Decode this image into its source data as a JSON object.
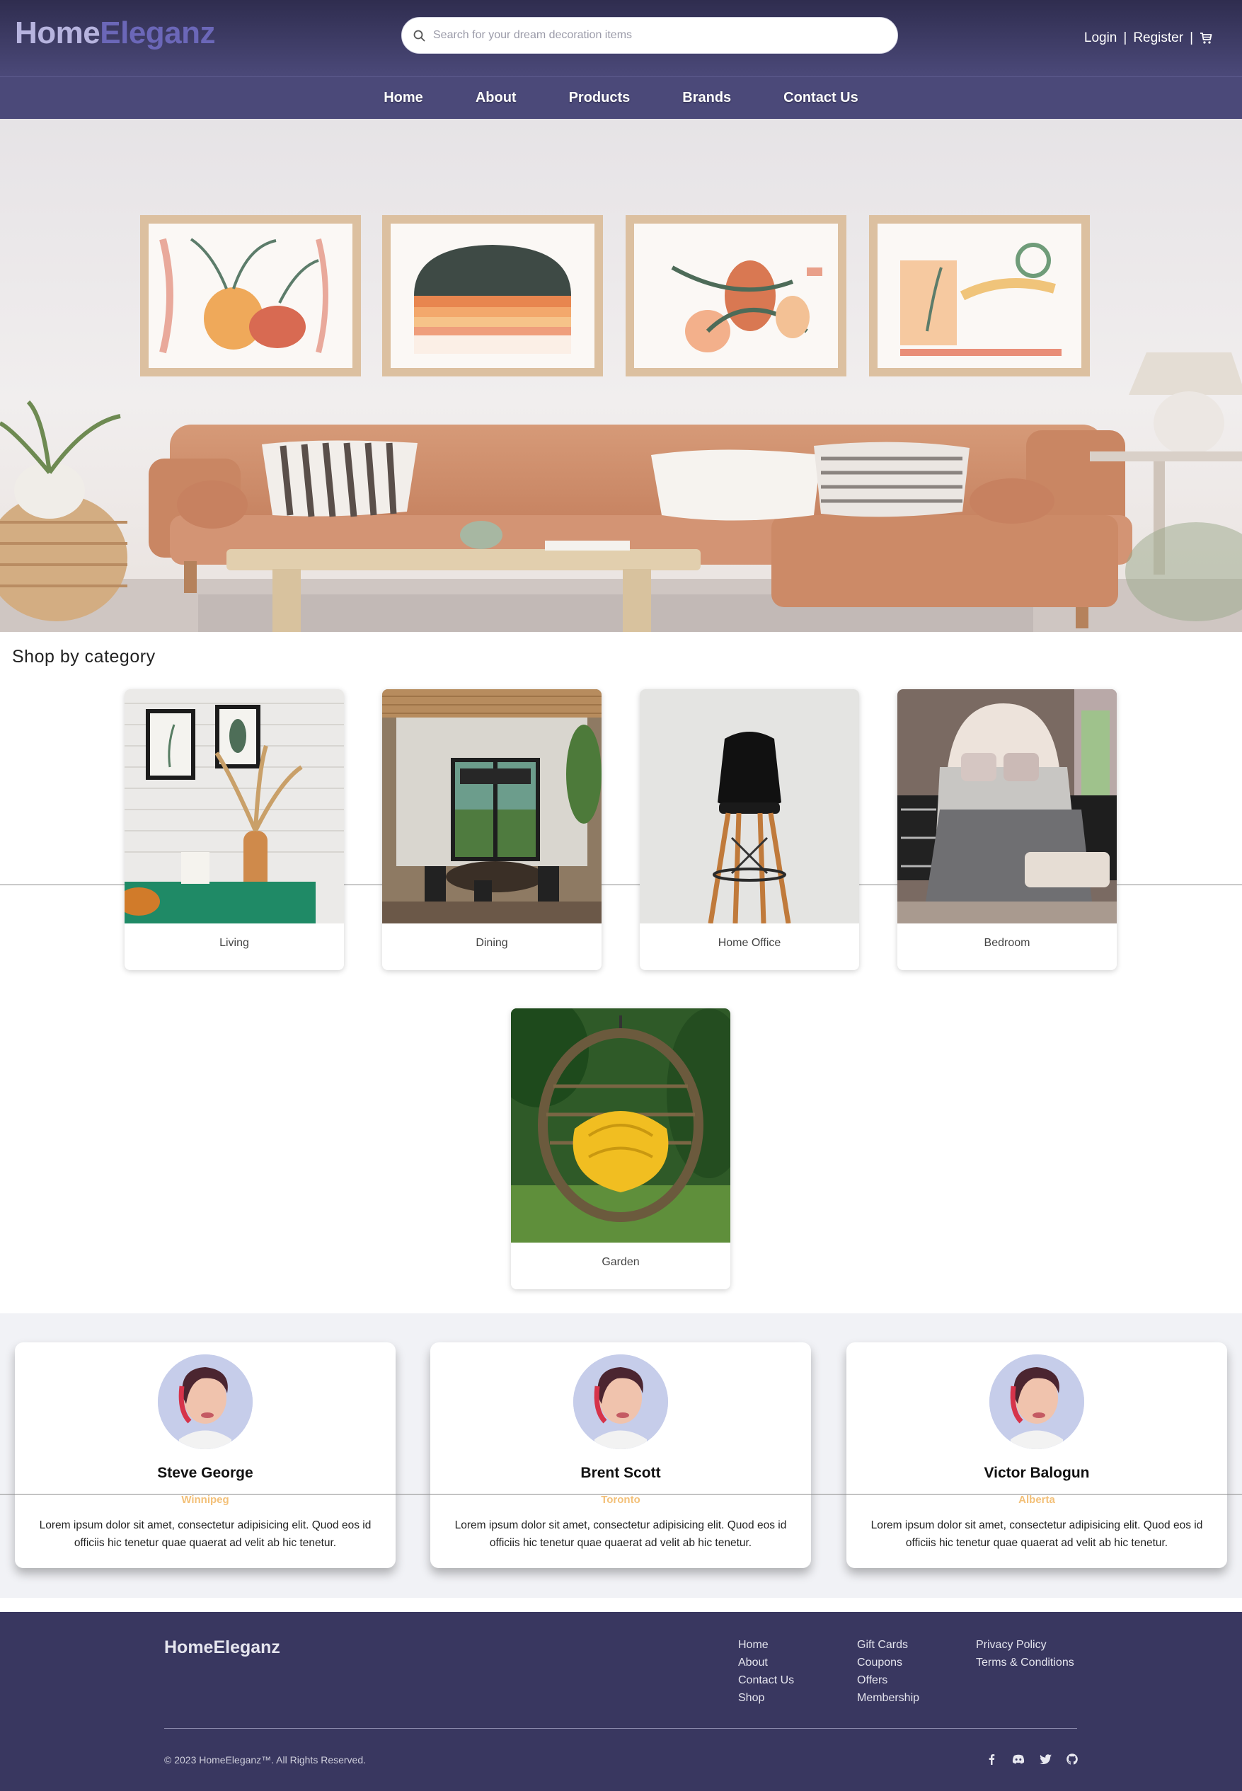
{
  "brand": {
    "name_part1": "Home",
    "name_part2": "Eleganz"
  },
  "search": {
    "placeholder": "Search for your dream decoration items",
    "icon": "search-icon"
  },
  "auth": {
    "login": "Login",
    "sep": "|",
    "register": "Register",
    "cart_icon": "cart-icon"
  },
  "nav": {
    "items": [
      "Home",
      "About",
      "Products",
      "Brands",
      "Contact Us"
    ]
  },
  "hero": {
    "image": "living-room-sofa-with-framed-art"
  },
  "categories": {
    "title": "Shop by category",
    "items": [
      "Living",
      "Dining",
      "Home Office",
      "Bedroom",
      "Garden"
    ]
  },
  "testimonials": [
    {
      "name": "Steve George",
      "city": "Winnipeg",
      "text": "Lorem ipsum dolor sit amet, consectetur adipisicing elit. Quod eos id officiis hic tenetur quae quaerat ad velit ab hic tenetur."
    },
    {
      "name": "Brent Scott",
      "city": "Toronto",
      "text": "Lorem ipsum dolor sit amet, consectetur adipisicing elit. Quod eos id officiis hic tenetur quae quaerat ad velit ab hic tenetur."
    },
    {
      "name": "Victor Balogun",
      "city": "Alberta",
      "text": "Lorem ipsum dolor sit amet, consectetur adipisicing elit. Quod eos id officiis hic tenetur quae quaerat ad velit ab hic tenetur."
    }
  ],
  "footer": {
    "logo": "HomeEleganz",
    "col1": [
      "Home",
      "About",
      "Contact Us",
      "Shop"
    ],
    "col2": [
      "Gift Cards",
      "Coupons",
      "Offers",
      "Membership"
    ],
    "col3": [
      "Privacy Policy",
      "Terms & Conditions"
    ],
    "copyright": "© 2023 HomeEleganz™. All Rights Reserved.",
    "social": [
      "facebook-icon",
      "discord-icon",
      "twitter-icon",
      "github-icon"
    ]
  },
  "colors": {
    "header": "#4b4979",
    "brand_light": "#b7b4df",
    "brand_accent": "#6b67b8",
    "city": "#f3c078",
    "footer": "#393760"
  }
}
